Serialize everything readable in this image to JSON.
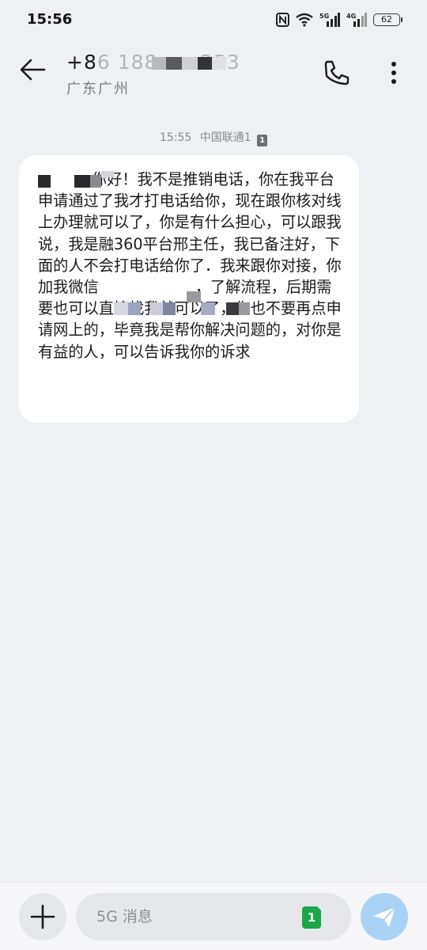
{
  "status_bar": {
    "time": "15:56",
    "network_1": "5G",
    "network_2": "4G",
    "battery": "62"
  },
  "header": {
    "contact_number": "+86 188 ···· 253",
    "contact_location": "广东广州"
  },
  "conversation": {
    "meta_time": "15:55",
    "meta_carrier": "中国联通1",
    "meta_sim": "1",
    "message": "        ，你好！我不是推销电话，你在我平台申请通过了我才打电话给你，现在跟你核对线上办理就可以了，你是有什么担心，可以跟我说，我是融360平台邢主任，我已备注好，下面的人不会打电话给你了．我来跟你对接，你加我微信                    ，了解流程，后期需要也可以直接找我就可以了，你也不要再点申请网上的，毕竟我是帮你解决问题的，对你是有益的人，可以告诉我你的诉求"
  },
  "composer": {
    "placeholder": "5G 消息",
    "sim_label": "1"
  },
  "colors": {
    "background": "#eff0f4",
    "bubble": "#ffffff",
    "send_button": "#a9d3f6",
    "sim_badge": "#1aa74a"
  },
  "icons": [
    "nfc-icon",
    "wifi-icon",
    "signal-icon",
    "back-arrow-icon",
    "phone-icon",
    "more-vertical-icon",
    "plus-icon",
    "send-icon"
  ]
}
